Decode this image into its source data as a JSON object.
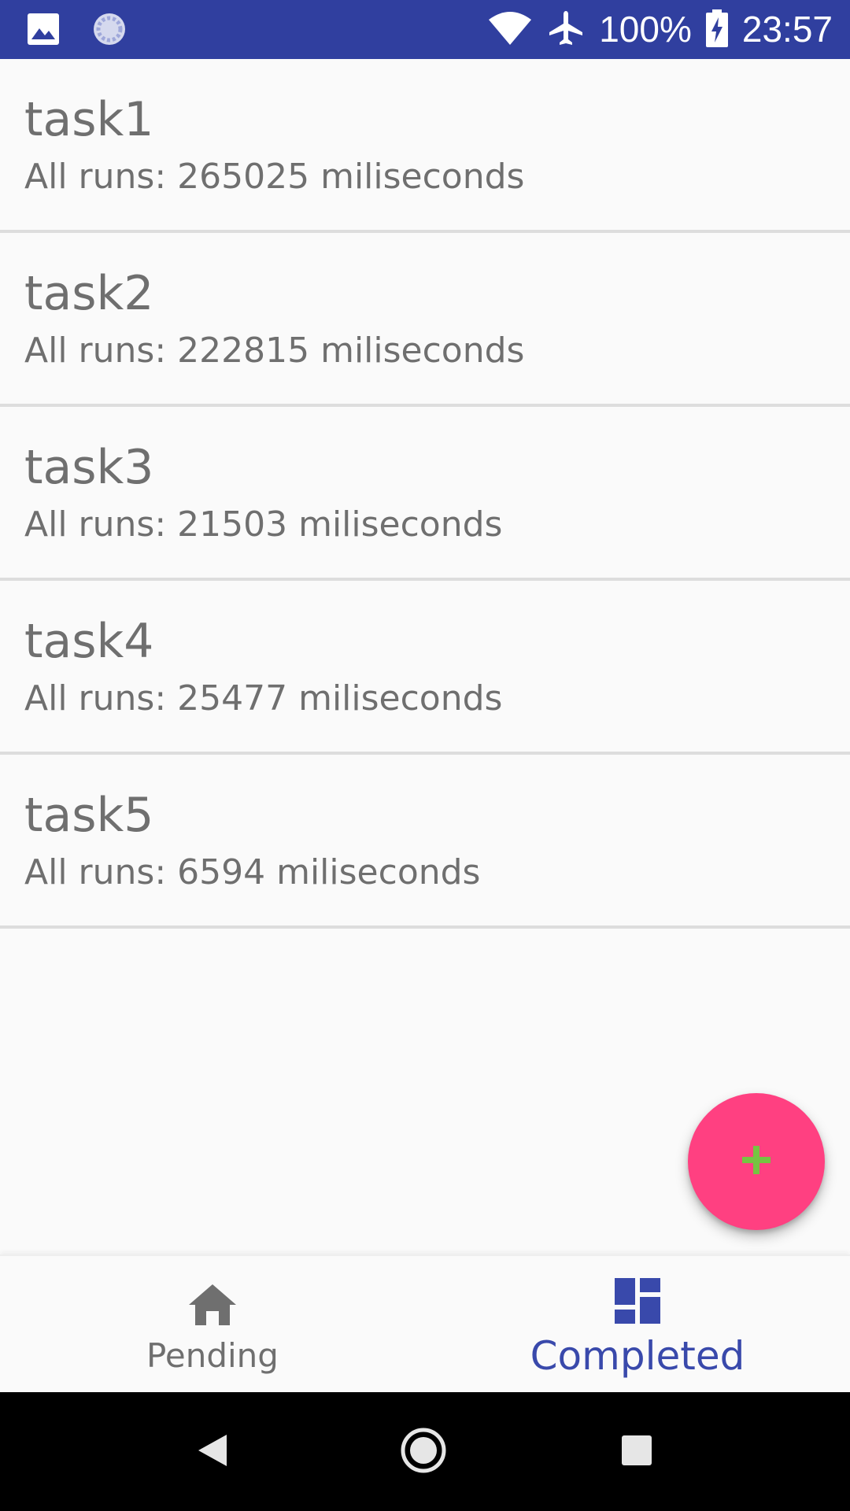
{
  "status_bar": {
    "battery": "100%",
    "time": "23:57",
    "icons": [
      "image-icon",
      "sync-icon",
      "wifi-icon",
      "airplane-icon",
      "battery-charging-icon"
    ]
  },
  "tasks": [
    {
      "name": "task1",
      "runs": "All runs: 265025 miliseconds"
    },
    {
      "name": "task2",
      "runs": "All runs: 222815 miliseconds"
    },
    {
      "name": "task3",
      "runs": "All runs: 21503 miliseconds"
    },
    {
      "name": "task4",
      "runs": "All runs: 25477 miliseconds"
    },
    {
      "name": "task5",
      "runs": "All runs: 6594 miliseconds"
    }
  ],
  "fab": {
    "icon": "plus-icon"
  },
  "bottom_nav": {
    "items": [
      {
        "label": "Pending",
        "icon": "home-icon"
      },
      {
        "label": "Completed",
        "icon": "dashboard-icon",
        "selected": true
      }
    ]
  },
  "system_nav": {
    "buttons": [
      "back-icon",
      "home-circle-icon",
      "recents-icon"
    ]
  },
  "colors": {
    "status_bar": "#303f9f",
    "accent": "#ff4081",
    "primary": "#3949ab",
    "text": "#6f6f6f",
    "plus": "#76c442"
  }
}
